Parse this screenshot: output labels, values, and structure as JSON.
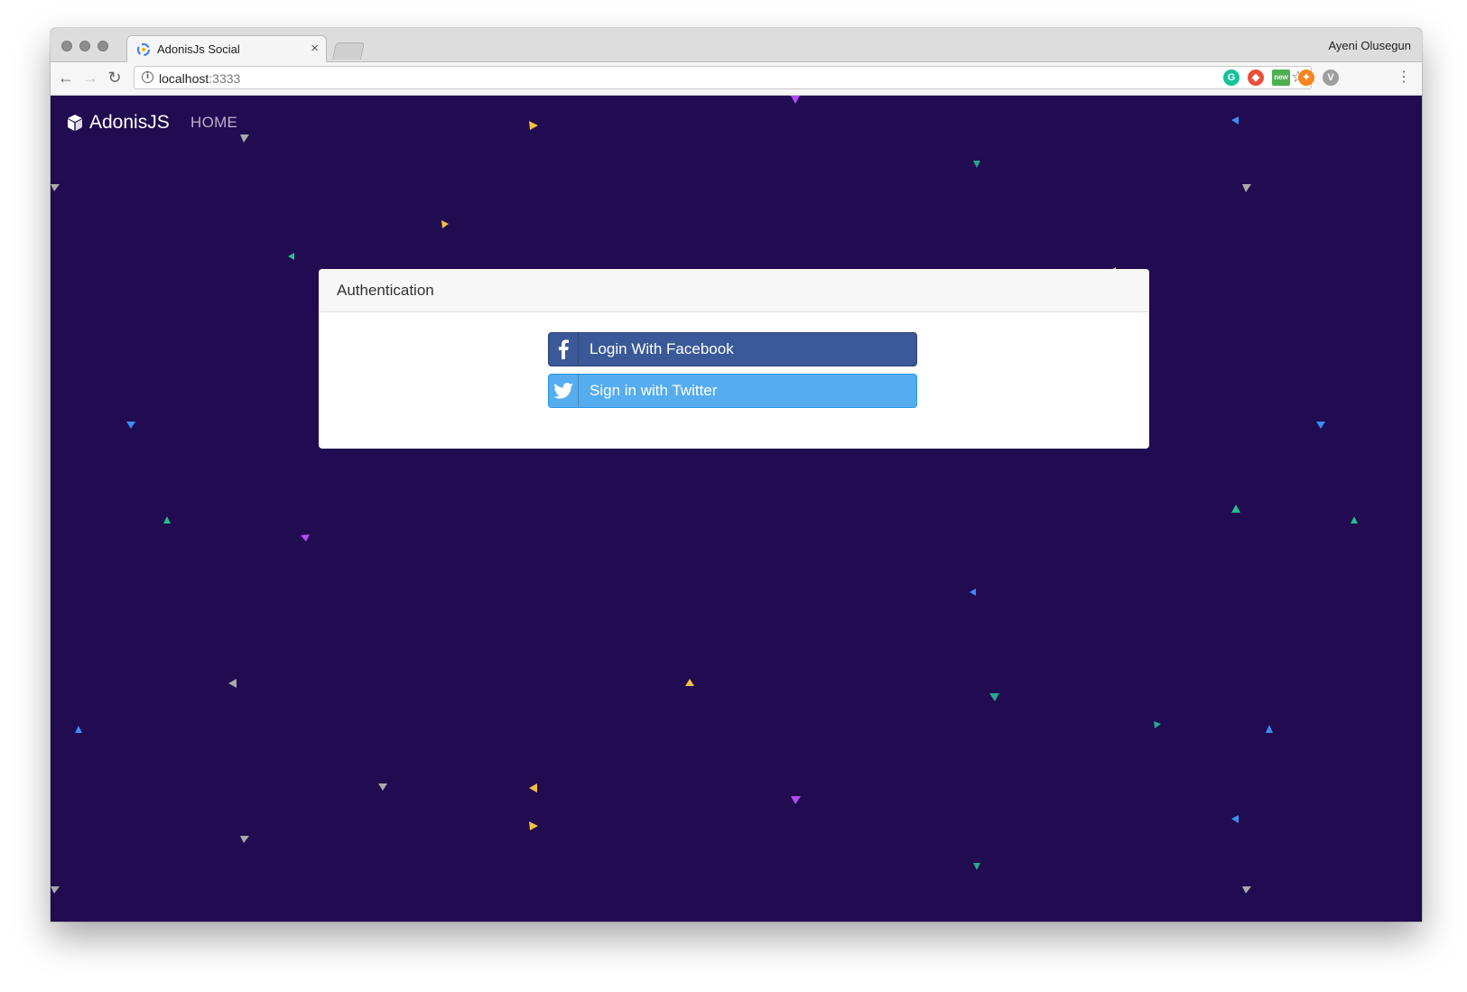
{
  "browser": {
    "tab_title": "AdonisJs Social",
    "tab_close": "×",
    "profile_name": "Ayeni Olusegun",
    "url_host": "localhost",
    "url_port": ":3333",
    "nav": {
      "back": "←",
      "forward": "→",
      "reload": "↻"
    },
    "info_glyph": "i",
    "bookmark_glyph": "☆",
    "menu_glyph": "⋮",
    "extensions": [
      {
        "name": "grammarly-icon",
        "color": "#15c39a",
        "glyph": "G"
      },
      {
        "name": "color-picker-icon",
        "color": "#e94f3a",
        "glyph": "◆"
      },
      {
        "name": "new-badge-icon",
        "color": "#4caf50",
        "glyph": "new"
      },
      {
        "name": "metamask-icon",
        "color": "#f6851b",
        "glyph": "✦"
      },
      {
        "name": "vue-devtools-icon",
        "color": "#9e9e9e",
        "glyph": "V"
      }
    ]
  },
  "page": {
    "brand": "AdonisJS",
    "nav_home": "HOME",
    "card_title": "Authentication",
    "facebook_label": "Login With Facebook",
    "twitter_label": "Sign in with Twitter"
  },
  "colors": {
    "page_bg": "#210b51",
    "facebook": "#3b5998",
    "twitter": "#55acee"
  }
}
